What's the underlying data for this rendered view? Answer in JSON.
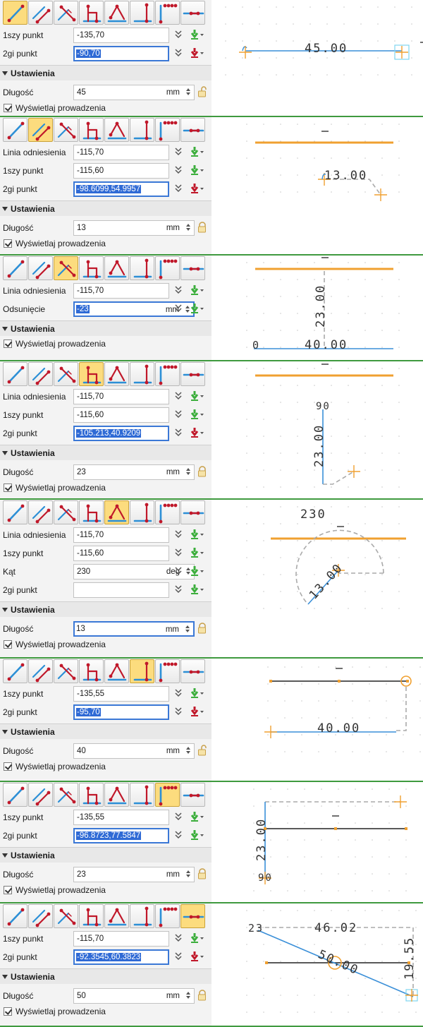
{
  "colors": {
    "accent_orange": "#f0a030",
    "line_blue": "#3a8fd8",
    "tool_red": "#c0182a",
    "tool_blue": "#2c8fd6",
    "active_tool": "#fcdc7e",
    "separator_green": "#3f9a3f",
    "selection_blue": "#2f6ad5"
  },
  "icons": {
    "tools": [
      "line-tool-icon",
      "parallel-line-tool-icon",
      "offset-line-tool-icon",
      "perpendicular-line-tool-icon",
      "angle-line-tool-icon",
      "vertical-line-tool-icon",
      "corner-line-tool-icon",
      "tangent-line-tool-icon"
    ],
    "snap": "snap-point-icon",
    "chevron": "double-chevron-down-icon",
    "lock": "lock-icon"
  },
  "settings_label": "Ustawienia",
  "show_guides_label": "Wyświetlaj prowadzenia",
  "panels": [
    {
      "active_tool": 0,
      "fields": [
        {
          "label": "1szy punkt",
          "value": "-135,70",
          "focus": false,
          "snap": "green"
        },
        {
          "label": "2gi punkt",
          "value": "-90,70",
          "focus": true,
          "snap": "red"
        }
      ],
      "settings": [
        {
          "label": "Długość",
          "value": "45",
          "unit": "mm",
          "lock": "open"
        }
      ],
      "canvas": {
        "dimension": "45.00"
      }
    },
    {
      "active_tool": 1,
      "fields": [
        {
          "label": "Linia odniesienia",
          "value": "-115,70",
          "focus": false,
          "snap": "green"
        },
        {
          "label": "1szy punkt",
          "value": "-115,60",
          "focus": false,
          "snap": "green"
        },
        {
          "label": "2gi punkt",
          "value": "-98.6099,54.9957",
          "focus": true,
          "snap": "red"
        }
      ],
      "settings": [
        {
          "label": "Długość",
          "value": "13",
          "unit": "mm",
          "lock": "closed"
        }
      ],
      "canvas": {
        "dimension": "13.00"
      }
    },
    {
      "active_tool": 2,
      "fields": [
        {
          "label": "Linia odniesienia",
          "value": "-115,70",
          "focus": false,
          "snap": "green"
        },
        {
          "label": "Odsunięcie",
          "value": "-23",
          "unit": "mm",
          "focus": true,
          "snap": "green"
        }
      ],
      "settings": [],
      "canvas": {
        "dimension_v": "23.00",
        "dimension_h": "40.00",
        "zero": "0"
      }
    },
    {
      "active_tool": 3,
      "fields": [
        {
          "label": "Linia odniesienia",
          "value": "-115,70",
          "focus": false,
          "snap": "green"
        },
        {
          "label": "1szy punkt",
          "value": "-115,60",
          "focus": false,
          "snap": "green"
        },
        {
          "label": "2gi punkt",
          "value": "-105.213,40.9209",
          "focus": true,
          "snap": "red"
        }
      ],
      "settings": [
        {
          "label": "Długość",
          "value": "23",
          "unit": "mm",
          "lock": "closed"
        }
      ],
      "canvas": {
        "dimension": "23.00",
        "angle": "90"
      }
    },
    {
      "active_tool": 4,
      "fields": [
        {
          "label": "Linia odniesienia",
          "value": "-115,70",
          "focus": false,
          "snap": "green"
        },
        {
          "label": "1szy punkt",
          "value": "-115,60",
          "focus": false,
          "snap": "green"
        },
        {
          "label": "Kąt",
          "value": "230",
          "unit": "deg",
          "focus": false,
          "snap": "green"
        },
        {
          "label": "2gi punkt",
          "value": "",
          "focus": false,
          "snap": "green"
        }
      ],
      "settings": [
        {
          "label": "Długość",
          "value": "13",
          "unit": "mm",
          "lock": "closed",
          "focus": true
        }
      ],
      "canvas": {
        "angle": "230",
        "dimension": "13.00"
      }
    },
    {
      "active_tool": 5,
      "fields": [
        {
          "label": "1szy punkt",
          "value": "-135,55",
          "focus": false,
          "snap": "green"
        },
        {
          "label": "2gi punkt",
          "value": "-95,70",
          "focus": true,
          "snap": "red"
        }
      ],
      "settings": [
        {
          "label": "Długość",
          "value": "40",
          "unit": "mm",
          "lock": "open"
        }
      ],
      "canvas": {
        "dimension": "40.00"
      }
    },
    {
      "active_tool": 6,
      "fields": [
        {
          "label": "1szy punkt",
          "value": "-135,55",
          "focus": false,
          "snap": "green"
        },
        {
          "label": "2gi punkt",
          "value": "-96.8723,77.5847",
          "focus": true,
          "snap": "green"
        }
      ],
      "settings": [
        {
          "label": "Długość",
          "value": "23",
          "unit": "mm",
          "lock": "closed"
        }
      ],
      "canvas": {
        "dimension": "23.00",
        "angle": "90"
      }
    },
    {
      "active_tool": 7,
      "fields": [
        {
          "label": "1szy punkt",
          "value": "-115,70",
          "focus": false,
          "snap": "green"
        },
        {
          "label": "2gi punkt",
          "value": "-92.3545,60.3823",
          "focus": true,
          "snap": "red"
        }
      ],
      "settings": [
        {
          "label": "Długość",
          "value": "50",
          "unit": "mm",
          "lock": "closed"
        }
      ],
      "canvas": {
        "angle": "23",
        "dimension_top": "46.02",
        "dimension_diag": "50.00",
        "dimension_v": "19.55"
      }
    }
  ]
}
